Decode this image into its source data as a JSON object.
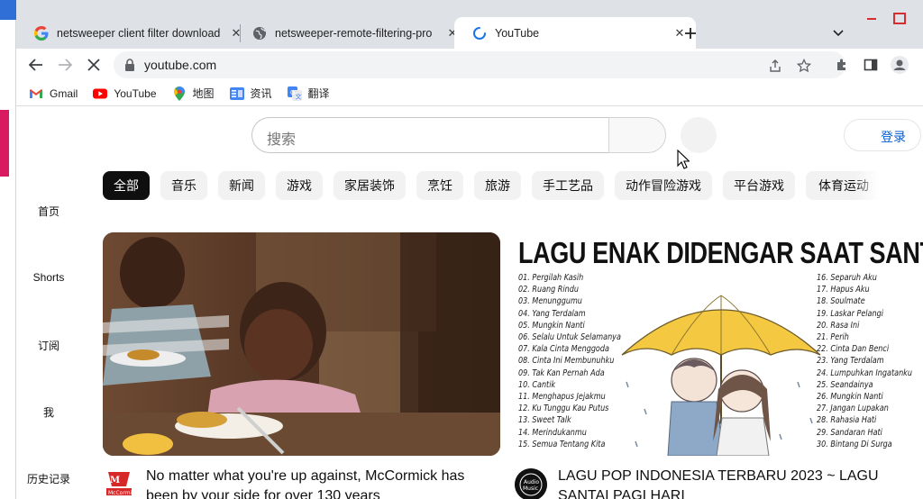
{
  "tabs": [
    {
      "title": "netsweeper client filter download",
      "favicon": "google-icon"
    },
    {
      "title": "netsweeper-remote-filtering-pro",
      "favicon": "globe-icon"
    },
    {
      "title": "YouTube",
      "favicon": "loading-spinner-icon",
      "active": true
    }
  ],
  "toolbar": {
    "url": "youtube.com"
  },
  "bookmarks": [
    {
      "label": "Gmail",
      "icon": "gmail-icon"
    },
    {
      "label": "YouTube",
      "icon": "youtube-icon"
    },
    {
      "label": "地图",
      "icon": "maps-icon"
    },
    {
      "label": "资讯",
      "icon": "news-icon"
    },
    {
      "label": "翻译",
      "icon": "translate-icon"
    }
  ],
  "youtube": {
    "search_placeholder": "搜索",
    "signin_label": "登录",
    "chips": [
      "全部",
      "音乐",
      "新闻",
      "游戏",
      "家居装饰",
      "烹饪",
      "旅游",
      "手工艺品",
      "动作冒险游戏",
      "平台游戏",
      "体育运动"
    ],
    "sidebar": [
      "首页",
      "Shorts",
      "订阅",
      "我",
      "历史记录"
    ],
    "videos": [
      {
        "title": "No matter what you're up against, McCormick has",
        "title_line2": "been by your side for over 130 years",
        "channel_avatar": "mccormick-logo"
      },
      {
        "title": "LAGU POP INDONESIA TERBARU 2023 ~ LAGU",
        "title_line2": "SANTAI PAGI HARI",
        "channel_avatar": "lagu-channel-logo",
        "thumbnail": {
          "headline": "LAGU ENAK DIDENGAR SAAT SANTAI",
          "songs_left": [
            "01. Pergilah Kasih",
            "02. Ruang Rindu",
            "03. Menunggumu",
            "04. Yang Terdalam",
            "05. Mungkin Nanti",
            "06. Selalu Untuk Selamanya",
            "07. Kala Cinta Menggoda",
            "08. Cinta Ini Membunuhku",
            "09. Tak Kan Pernah Ada",
            "10. Cantik",
            "11. Menghapus Jejakmu",
            "12. Ku Tunggu Kau Putus",
            "13. Sweet Talk",
            "14. Merindukanmu",
            "15. Semua Tentang Kita"
          ],
          "songs_right": [
            "16. Separuh Aku",
            "17. Hapus Aku",
            "18. Soulmate",
            "19. Laskar Pelangi",
            "20. Rasa Ini",
            "21. Perih",
            "22. Cinta Dan Benci",
            "23. Yang Terdalam",
            "24. Lumpuhkan Ingatanku",
            "25. Seandainya",
            "26. Mungkin Nanti",
            "27. Jangan Lupakan",
            "28. Rahasia Hati",
            "29. Sandaran Hati",
            "30. Bintang Di Surga"
          ]
        }
      }
    ]
  }
}
